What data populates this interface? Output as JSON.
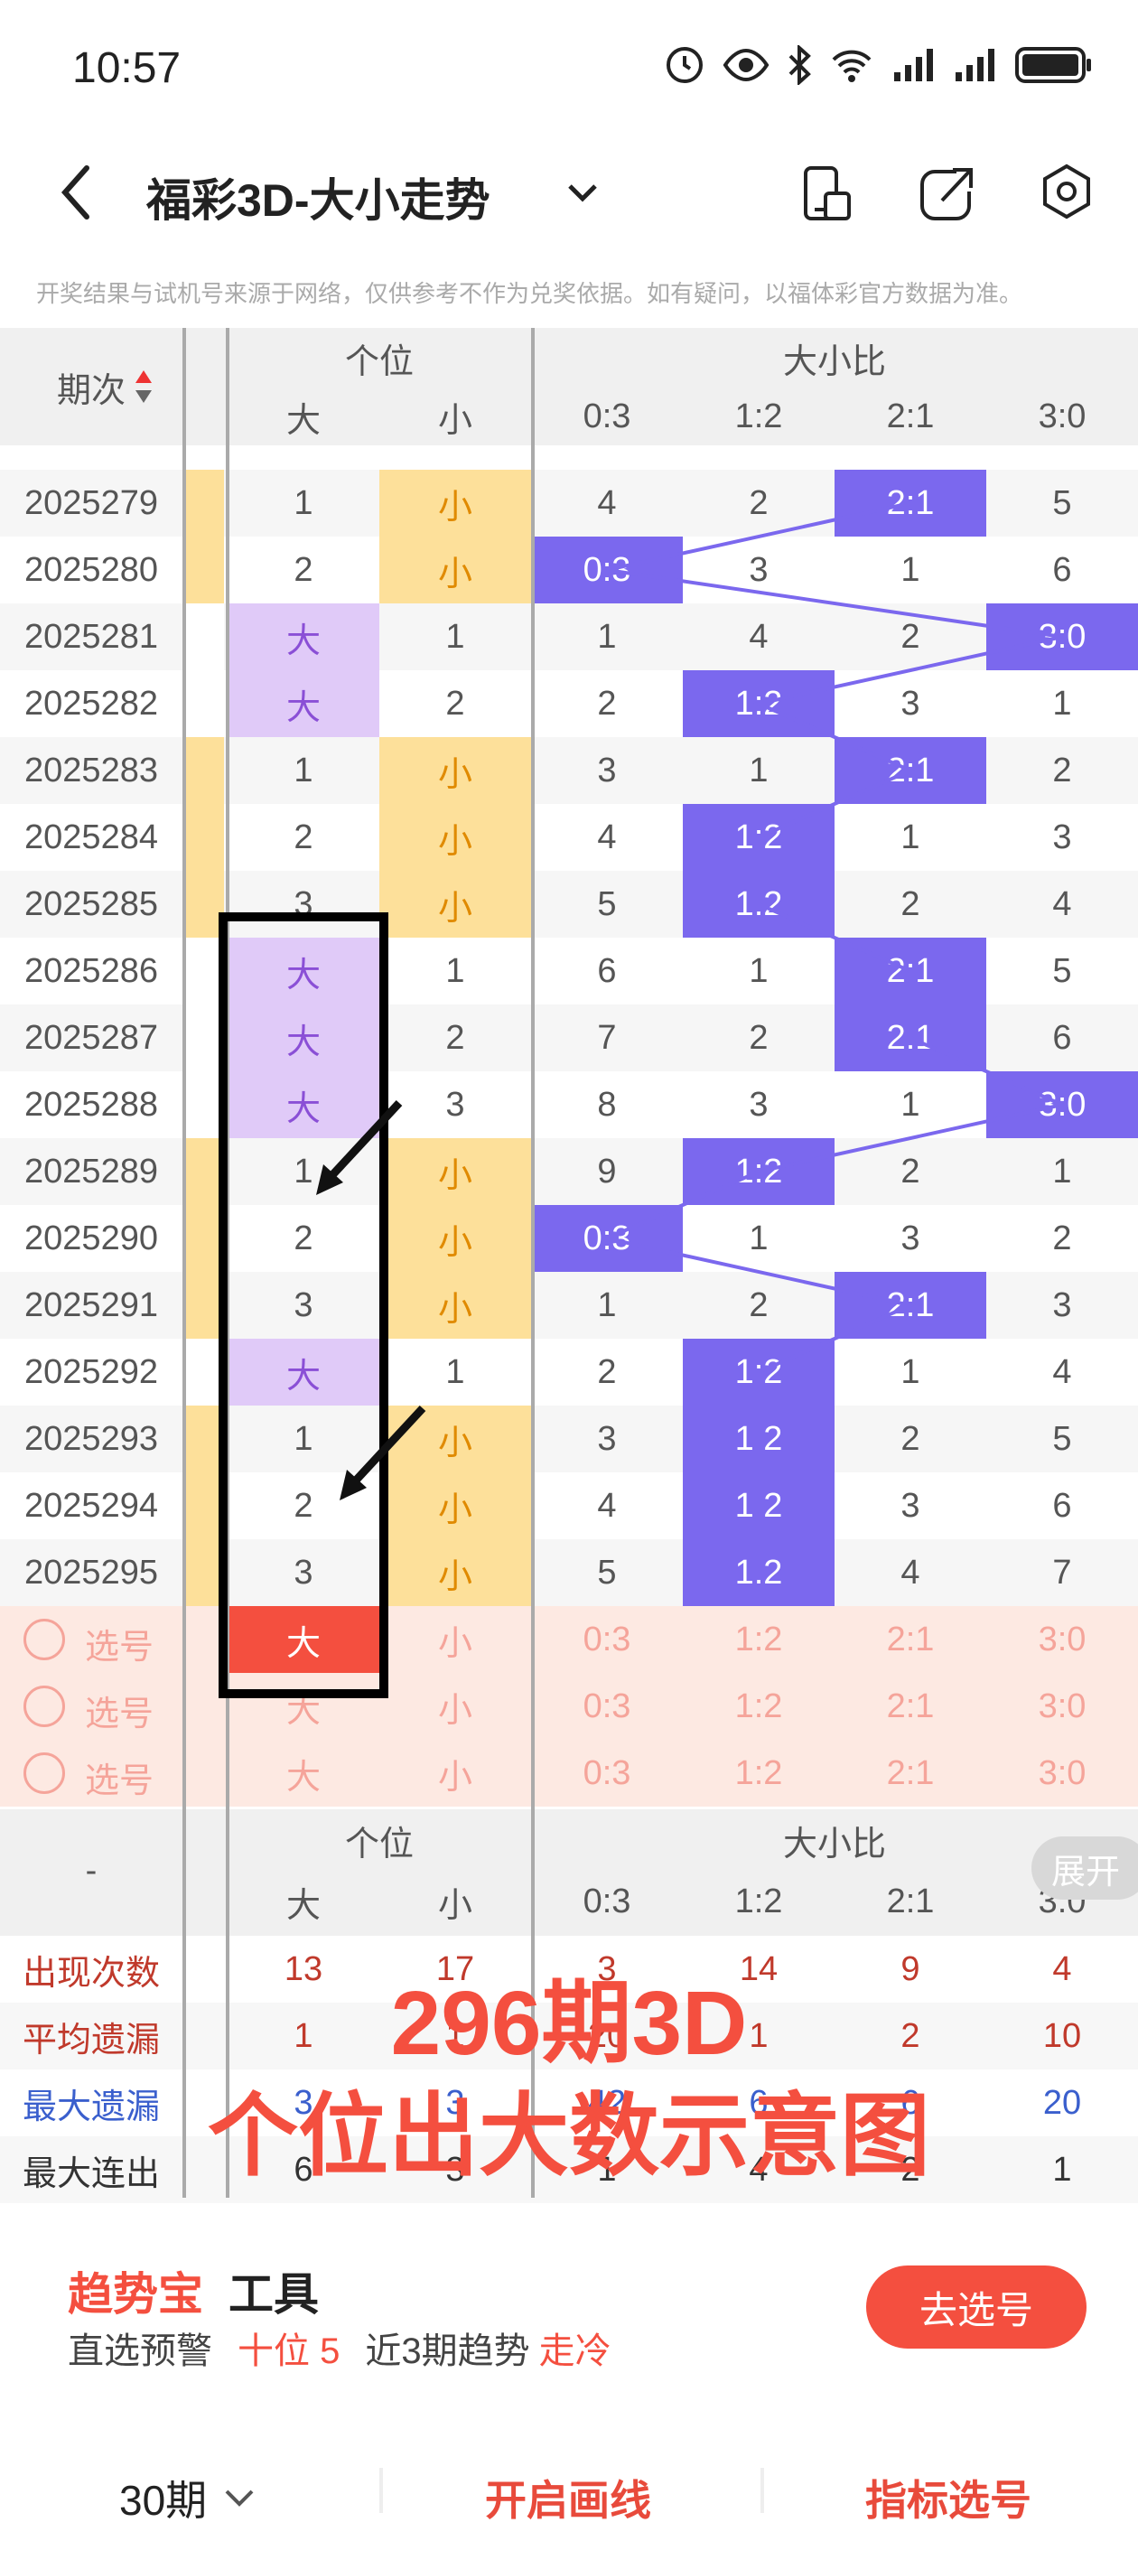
{
  "status": {
    "time": "10:57"
  },
  "header": {
    "title": "福彩3D-大小走势"
  },
  "notice": "开奖结果与试机号来源于网络，仅供参考不作为兑奖依据。如有疑问，以福体彩官方数据为准。",
  "table": {
    "col_period": "期次",
    "group1": "个位",
    "group2": "大小比",
    "sub_big": "大",
    "sub_small": "小",
    "ratios": [
      "0:3",
      "1:2",
      "2:1",
      "3:0"
    ],
    "rows": [
      {
        "period": "2025279",
        "big": "1",
        "small": "小",
        "r": [
          "4",
          "2",
          "2:1",
          "5"
        ],
        "hit": 2,
        "gw": "small"
      },
      {
        "period": "2025280",
        "big": "2",
        "small": "小",
        "r": [
          "0:3",
          "3",
          "1",
          "6"
        ],
        "hit": 0,
        "gw": "small"
      },
      {
        "period": "2025281",
        "big": "大",
        "small": "1",
        "r": [
          "1",
          "4",
          "2",
          "3:0"
        ],
        "hit": 3,
        "gw": "big"
      },
      {
        "period": "2025282",
        "big": "大",
        "small": "2",
        "r": [
          "2",
          "1:2",
          "3",
          "1"
        ],
        "hit": 1,
        "gw": "big"
      },
      {
        "period": "2025283",
        "big": "1",
        "small": "小",
        "r": [
          "3",
          "1",
          "2:1",
          "2"
        ],
        "hit": 2,
        "gw": "small"
      },
      {
        "period": "2025284",
        "big": "2",
        "small": "小",
        "r": [
          "4",
          "1:2",
          "1",
          "3"
        ],
        "hit": 1,
        "gw": "small"
      },
      {
        "period": "2025285",
        "big": "3",
        "small": "小",
        "r": [
          "5",
          "1:2",
          "2",
          "4"
        ],
        "hit": 1,
        "gw": "small"
      },
      {
        "period": "2025286",
        "big": "大",
        "small": "1",
        "r": [
          "6",
          "1",
          "2:1",
          "5"
        ],
        "hit": 2,
        "gw": "big"
      },
      {
        "period": "2025287",
        "big": "大",
        "small": "2",
        "r": [
          "7",
          "2",
          "2:1",
          "6"
        ],
        "hit": 2,
        "gw": "big"
      },
      {
        "period": "2025288",
        "big": "大",
        "small": "3",
        "r": [
          "8",
          "3",
          "1",
          "3:0"
        ],
        "hit": 3,
        "gw": "big"
      },
      {
        "period": "2025289",
        "big": "1",
        "small": "小",
        "r": [
          "9",
          "1:2",
          "2",
          "1"
        ],
        "hit": 1,
        "gw": "small"
      },
      {
        "period": "2025290",
        "big": "2",
        "small": "小",
        "r": [
          "0:3",
          "1",
          "3",
          "2"
        ],
        "hit": 0,
        "gw": "small"
      },
      {
        "period": "2025291",
        "big": "3",
        "small": "小",
        "r": [
          "1",
          "2",
          "2:1",
          "3"
        ],
        "hit": 2,
        "gw": "small"
      },
      {
        "period": "2025292",
        "big": "大",
        "small": "1",
        "r": [
          "2",
          "1:2",
          "1",
          "4"
        ],
        "hit": 1,
        "gw": "big"
      },
      {
        "period": "2025293",
        "big": "1",
        "small": "小",
        "r": [
          "3",
          "1:2",
          "2",
          "5"
        ],
        "hit": 1,
        "gw": "small"
      },
      {
        "period": "2025294",
        "big": "2",
        "small": "小",
        "r": [
          "4",
          "1:2",
          "3",
          "6"
        ],
        "hit": 1,
        "gw": "small"
      },
      {
        "period": "2025295",
        "big": "3",
        "small": "小",
        "r": [
          "5",
          "1:2",
          "4",
          "7"
        ],
        "hit": 1,
        "gw": "small"
      }
    ],
    "select_label": "选号"
  },
  "stats": {
    "dash": "-",
    "expand": "展开",
    "labels": [
      "出现次数",
      "平均遗漏",
      "最大遗漏",
      "最大连出"
    ],
    "rows": [
      [
        "13",
        "17",
        "3",
        "14",
        "9",
        "4"
      ],
      [
        "1",
        "1",
        "20",
        "1",
        "2",
        "10"
      ],
      [
        "3",
        "3",
        "42",
        "6",
        "6",
        "20"
      ],
      [
        "6",
        "3",
        "1",
        "4",
        "2",
        "1"
      ]
    ]
  },
  "overlay": {
    "line1": "296期3D",
    "line2": "个位出大数示意图"
  },
  "tool": {
    "brand": "趋势宝",
    "word": "工具",
    "l1": "直选预警",
    "v1": "十位 5",
    "l2": "近3期趋势",
    "v2": "走冷",
    "button": "去选号"
  },
  "bottom": {
    "periods": "30期",
    "draw": "开启画线",
    "indicator": "指标选号"
  },
  "colors": {
    "purple": "#7b68ee",
    "big_bg": "#e0caf8",
    "small_bg": "#fde09a",
    "red": "#f44f3f"
  }
}
